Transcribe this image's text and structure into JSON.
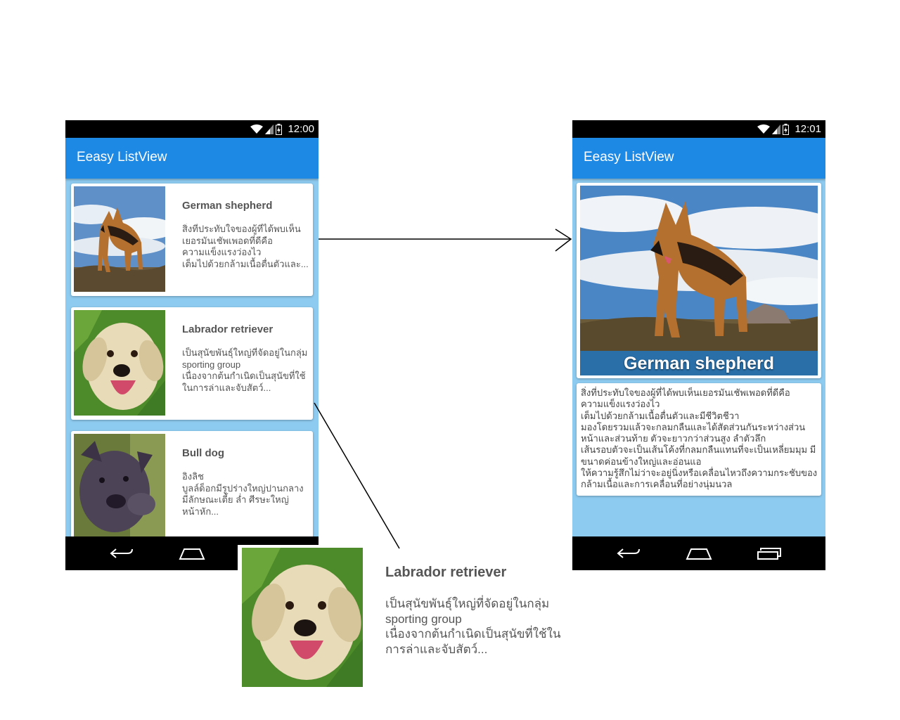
{
  "left_phone": {
    "status_time": "12:00",
    "app_title": "Eeasy ListView",
    "items": [
      {
        "name": "German shepherd",
        "description": "สิ่งที่ประทับใจของผู้ที่ได้พบเห็นเยอรมันเชัพเพอดที่ดีคือ\nความแข็งแรงว่องไว\nเต็มไปด้วยกล้ามเนื้อตื่นตัวและ..."
      },
      {
        "name": "Labrador retriever",
        "description": "เป็นสุนัขพันธุ์ใหญ่ที่จัดอยู่ในกลุ่ม sporting group\nเนื่องจากต้นกำเนิดเป็นสุนัขที่ใช้ในการล่าและจับสัตว์..."
      },
      {
        "name": "Bull dog",
        "description": "อิงลิช\nบูลล์ด็อกมีรูปร่างใหญ่ปานกลาง\nมีลักษณะเตี้ย ล่ำ ศีรษะใหญ่\nหน้าหัก..."
      }
    ]
  },
  "right_phone": {
    "status_time": "12:01",
    "app_title": "Eeasy ListView",
    "hero_title": "German shepherd",
    "detail_text": "สิ่งที่ประทับใจของผู้ที่ได้พบเห็นเยอรมันเชัพเพอดที่ดีคือ\nความแข็งแรงว่องไว\nเต็มไปด้วยกล้ามเนื้อตื่นตัวและมีชีวิตชีวา\nมองโดยรวมแล้วจะกลมกลืนและได้สัดส่วนกันระหว่างส่วนหน้าและส่วนท้าย ตัวจะยาวกว่าส่วนสูง ลำตัวลึก\nเส้นรอบตัวจะเป็นเส้นโค้งที่กลมกลืนแทนที่จะเป็นเหลี่ยมมุม มีขนาดค่อนข้างใหญ่และอ่อนแอ\nให้ความรู้สึกไม่ว่าจะอยู่นิ่งหรือเคลื่อนไหวถึงความกระชับของกล้ามเนื้อและการเคลื่อนที่อย่างนุ่มนวล"
  },
  "zoom": {
    "name": "Labrador retriever",
    "description": "เป็นสุนัขพันธุ์ใหญ่ที่จัดอยู่ในกลุ่ม sporting group\nเนื่องจากต้นกำเนิดเป็นสุนัขที่ใช้ในการล่าและจับสัตว์..."
  },
  "icons": [
    "wifi-icon",
    "signal-icon",
    "battery-icon",
    "back-icon",
    "home-icon",
    "recents-icon"
  ],
  "colors": {
    "app_bar": "#1e88e5",
    "list_background": "#8ecbf0",
    "status_bar": "#000000"
  }
}
